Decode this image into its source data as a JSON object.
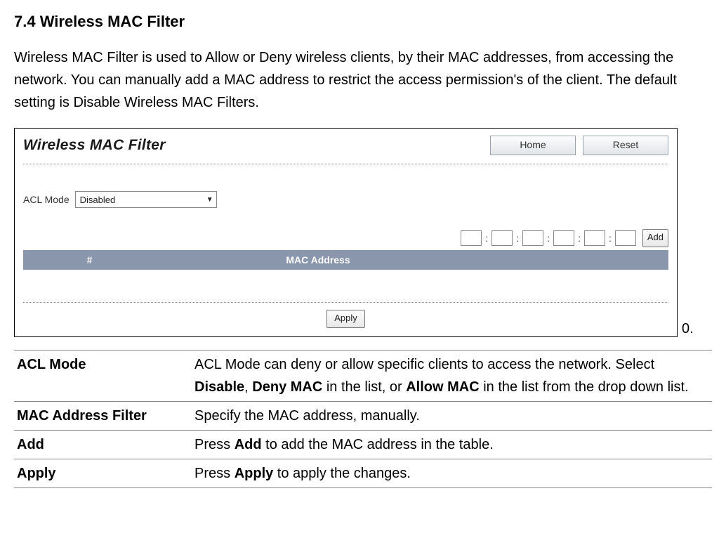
{
  "heading": "7.4 Wireless MAC Filter",
  "intro": "Wireless MAC Filter is used to Allow or Deny wireless clients, by their MAC addresses, from accessing the network. You can manually add a MAC address to restrict the access permission's of the client. The default setting is Disable Wireless MAC Filters.",
  "shot": {
    "title": "Wireless MAC Filter",
    "home_btn": "Home",
    "reset_btn": "Reset",
    "acl_label": "ACL Mode",
    "acl_value": "Disabled",
    "add_btn": "Add",
    "col_hash": "#",
    "col_mac": "MAC Address",
    "col_blank": "",
    "apply_btn": "Apply"
  },
  "trailing_zero": "0.",
  "desc": {
    "rows": [
      {
        "label": "ACL Mode",
        "pre": "ACL Mode can deny or allow specific clients to access the network. Select ",
        "b1": "Disable",
        "mid1": ", ",
        "b2": "Deny MAC",
        "mid2": " in the list, or ",
        "b3": "Allow MAC",
        "post": " in the list from the drop down list."
      },
      {
        "label": "MAC Address Filter",
        "text": "Specify the MAC address, manually."
      },
      {
        "label": "Add",
        "pre": "Press ",
        "b1": "Add",
        "post": " to add the MAC address in the table."
      },
      {
        "label": "Apply",
        "pre": "Press ",
        "b1": "Apply",
        "post": " to apply the changes."
      }
    ]
  }
}
